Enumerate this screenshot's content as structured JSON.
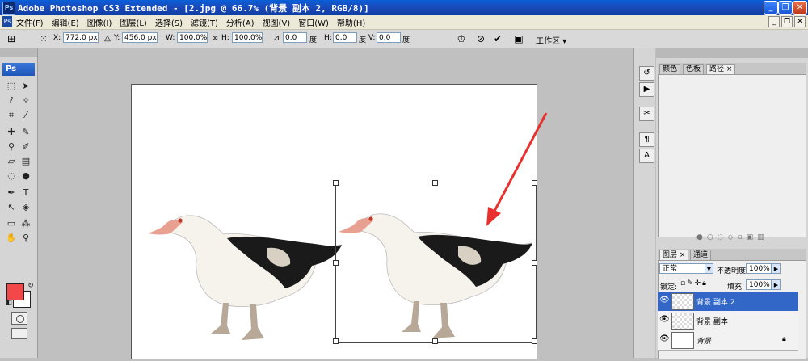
{
  "window": {
    "app_title": "Adobe Photoshop CS3 Extended - [2.jpg @ 66.7% (背景 副本 2, RGB/8)]",
    "logo_text": "Ps",
    "minimize": "_",
    "restore": "❐",
    "close": "✕"
  },
  "menu": {
    "icon_text": "Ps",
    "items": [
      "文件(F)",
      "编辑(E)",
      "图像(I)",
      "图层(L)",
      "选择(S)",
      "滤镜(T)",
      "分析(A)",
      "视图(V)",
      "窗口(W)",
      "帮助(H)"
    ],
    "mdi_minimize": "_",
    "mdi_restore": "❐",
    "mdi_close": "✕"
  },
  "options": {
    "x_label": "X:",
    "x_value": "772.0 px",
    "y_label": "Y:",
    "y_value": "456.0 px",
    "w_label": "W:",
    "w_value": "100.0%",
    "h_label": "H:",
    "h_value": "100.0%",
    "angle_value": "0.0",
    "angle_unit": "度",
    "hskew_label": "H:",
    "hskew_value": "0.0",
    "hskew_unit": "度",
    "vskew_label": "V:",
    "vskew_value": "0.0",
    "vskew_unit": "度",
    "workspace_label": "工作区 ▾"
  },
  "toolbox": {
    "badge": "Ps"
  },
  "panels": {
    "top_tabs": [
      "颜色",
      "色板",
      "路径 ×"
    ],
    "layer_tabs": [
      "图层 ×",
      "通道"
    ],
    "blend_mode": "正常",
    "opacity_label": "不透明度:",
    "opacity_value": "100%",
    "lock_label": "锁定:",
    "fill_label": "填充:",
    "fill_value": "100%",
    "layers": [
      {
        "name": "背景 副本 2",
        "selected": true
      },
      {
        "name": "背景 副本",
        "selected": false
      },
      {
        "name": "背景",
        "selected": false
      }
    ]
  },
  "colors": {
    "foreground": "#f2484a",
    "background": "#ffffff",
    "selection": "#3267c7",
    "annotation_arrow": "#e8312f"
  }
}
